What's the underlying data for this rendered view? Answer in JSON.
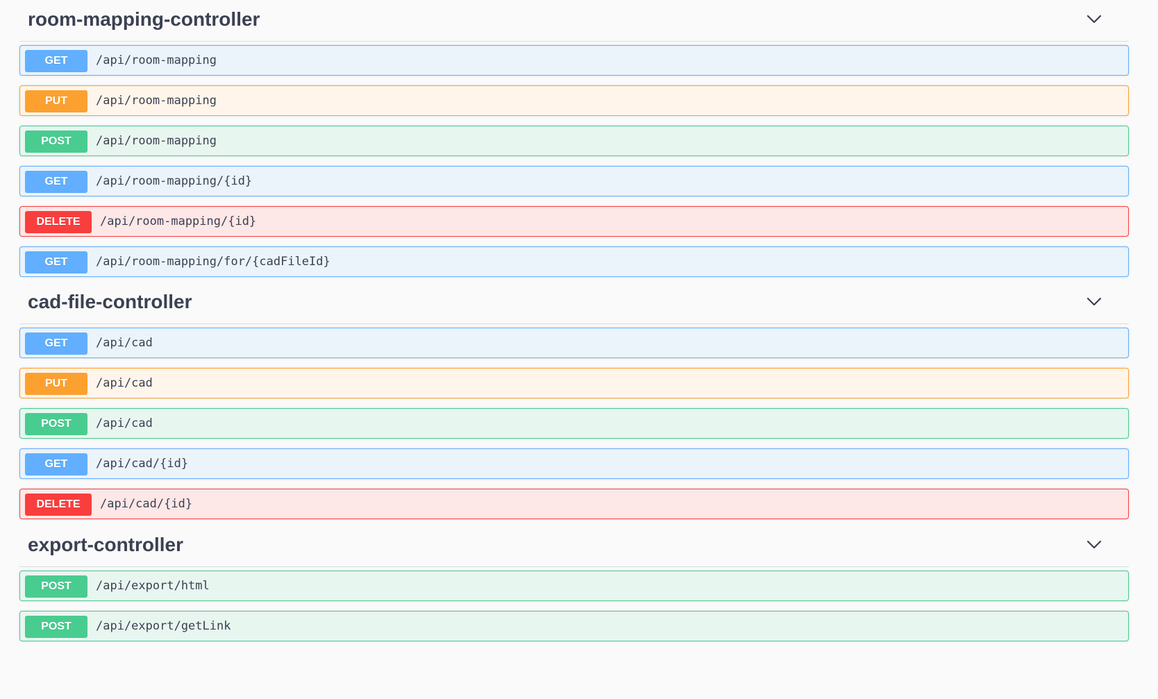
{
  "colors": {
    "get": "#61affe",
    "put": "#fca130",
    "post": "#49cc90",
    "delete": "#f93e3e",
    "title_text": "#3b4151"
  },
  "icons": {
    "expand": "chevron-down-icon"
  },
  "sections": [
    {
      "title": "room-mapping-controller",
      "operations": [
        {
          "method": "GET",
          "path": "/api/room-mapping"
        },
        {
          "method": "PUT",
          "path": "/api/room-mapping"
        },
        {
          "method": "POST",
          "path": "/api/room-mapping"
        },
        {
          "method": "GET",
          "path": "/api/room-mapping/{id}"
        },
        {
          "method": "DELETE",
          "path": "/api/room-mapping/{id}"
        },
        {
          "method": "GET",
          "path": "/api/room-mapping/for/{cadFileId}"
        }
      ]
    },
    {
      "title": "cad-file-controller",
      "operations": [
        {
          "method": "GET",
          "path": "/api/cad"
        },
        {
          "method": "PUT",
          "path": "/api/cad"
        },
        {
          "method": "POST",
          "path": "/api/cad"
        },
        {
          "method": "GET",
          "path": "/api/cad/{id}"
        },
        {
          "method": "DELETE",
          "path": "/api/cad/{id}"
        }
      ]
    },
    {
      "title": "export-controller",
      "operations": [
        {
          "method": "POST",
          "path": "/api/export/html"
        },
        {
          "method": "POST",
          "path": "/api/export/getLink"
        }
      ]
    }
  ]
}
